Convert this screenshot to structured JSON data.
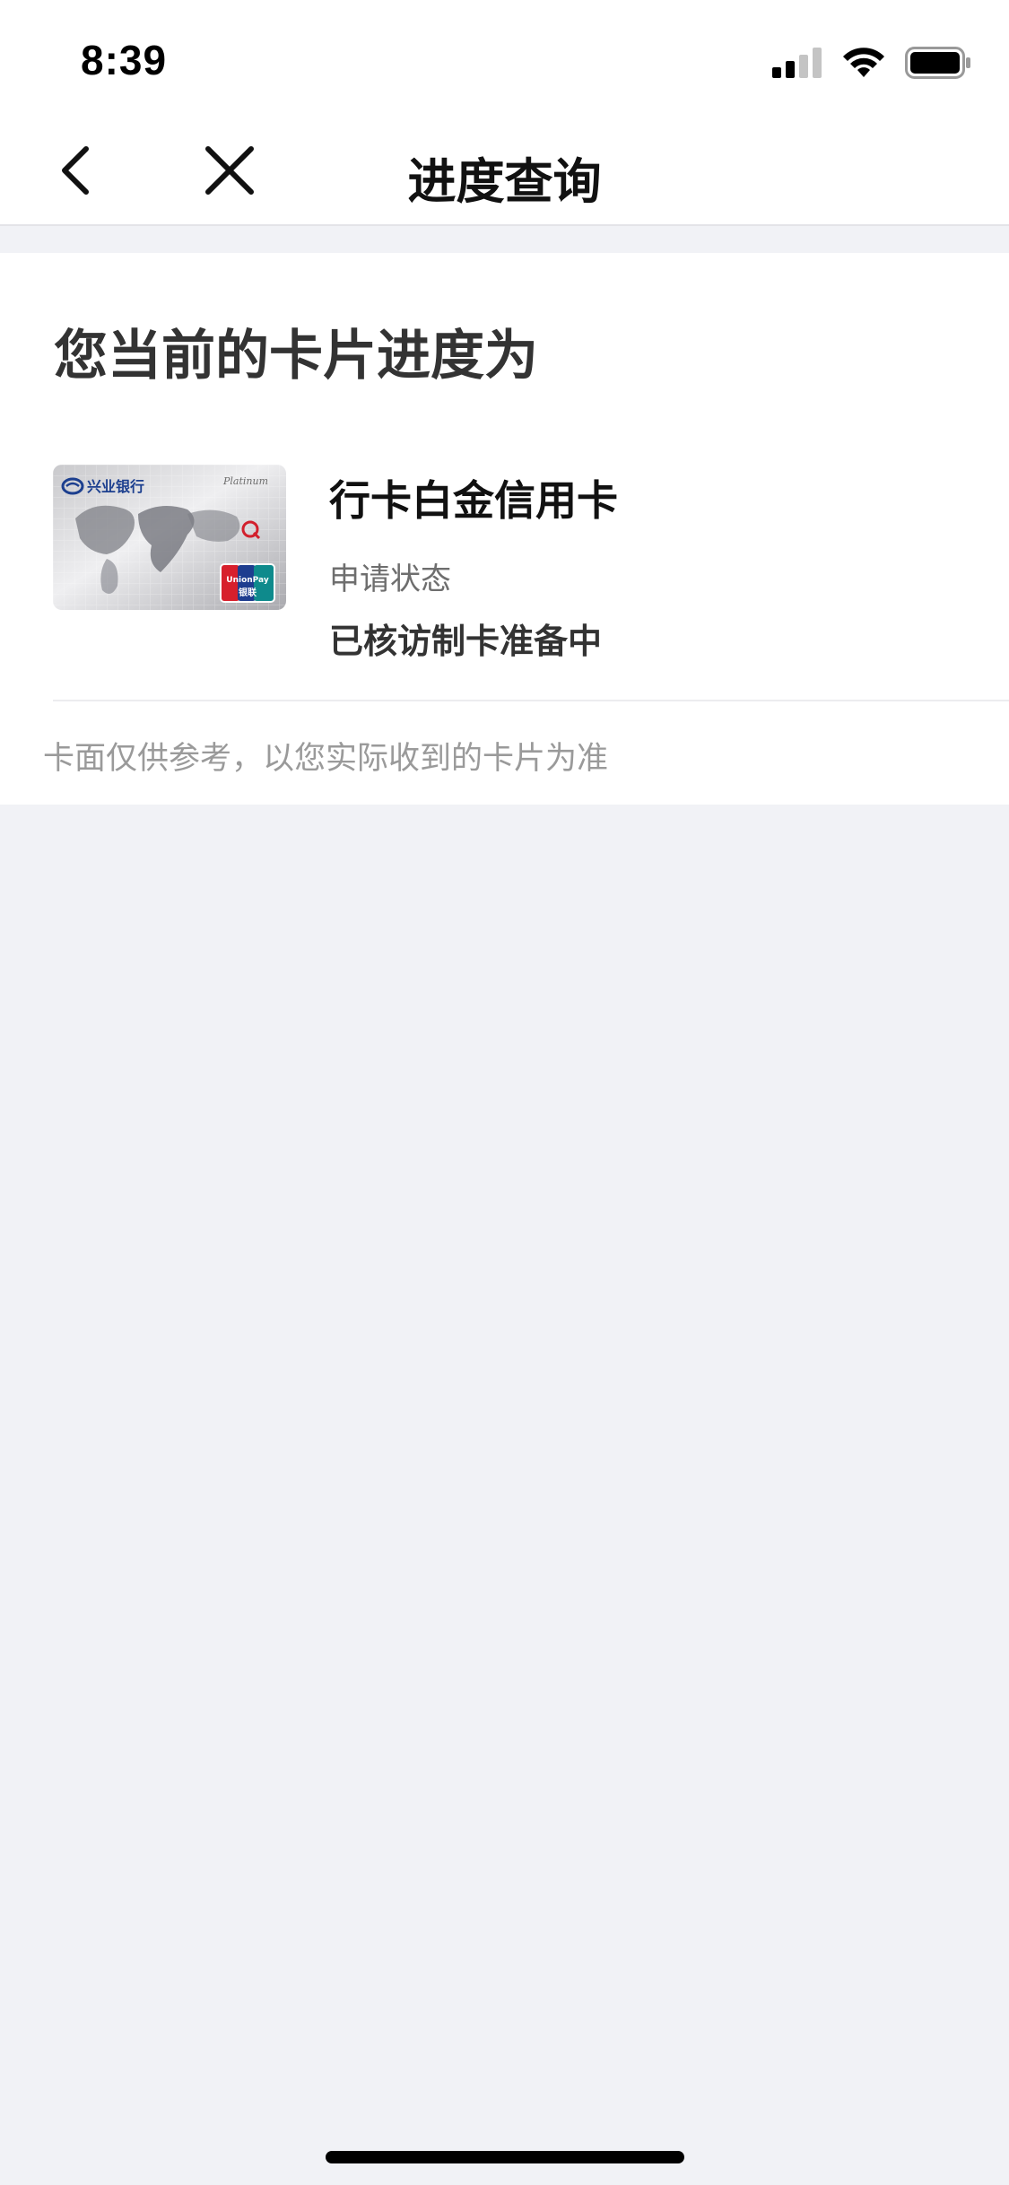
{
  "status_bar": {
    "time": "8:39",
    "signal_icon": "cellular-signal-icon",
    "wifi_icon": "wifi-icon",
    "battery_icon": "battery-icon"
  },
  "nav": {
    "back_icon": "chevron-left-icon",
    "close_icon": "close-icon",
    "title": "进度查询"
  },
  "progress": {
    "heading": "您当前的卡片进度为",
    "card": {
      "image_icon": "credit-card-image",
      "bank_logo_text": "兴业银行",
      "tier_text": "Platinum",
      "network_text": "UnionPay",
      "network_text_cn": "银联",
      "name": "行卡白金信用卡",
      "status_label": "申请状态",
      "status_value": "已核访制卡准备中"
    },
    "disclaimer": "卡面仅供参考，以您实际收到的卡片为准"
  },
  "colors": {
    "page_bg": "#f1f2f6",
    "surface": "#ffffff",
    "text_primary": "#111111",
    "text_secondary": "#6e6e6e",
    "text_hint": "#9a9a9a",
    "divider": "#ececef"
  }
}
